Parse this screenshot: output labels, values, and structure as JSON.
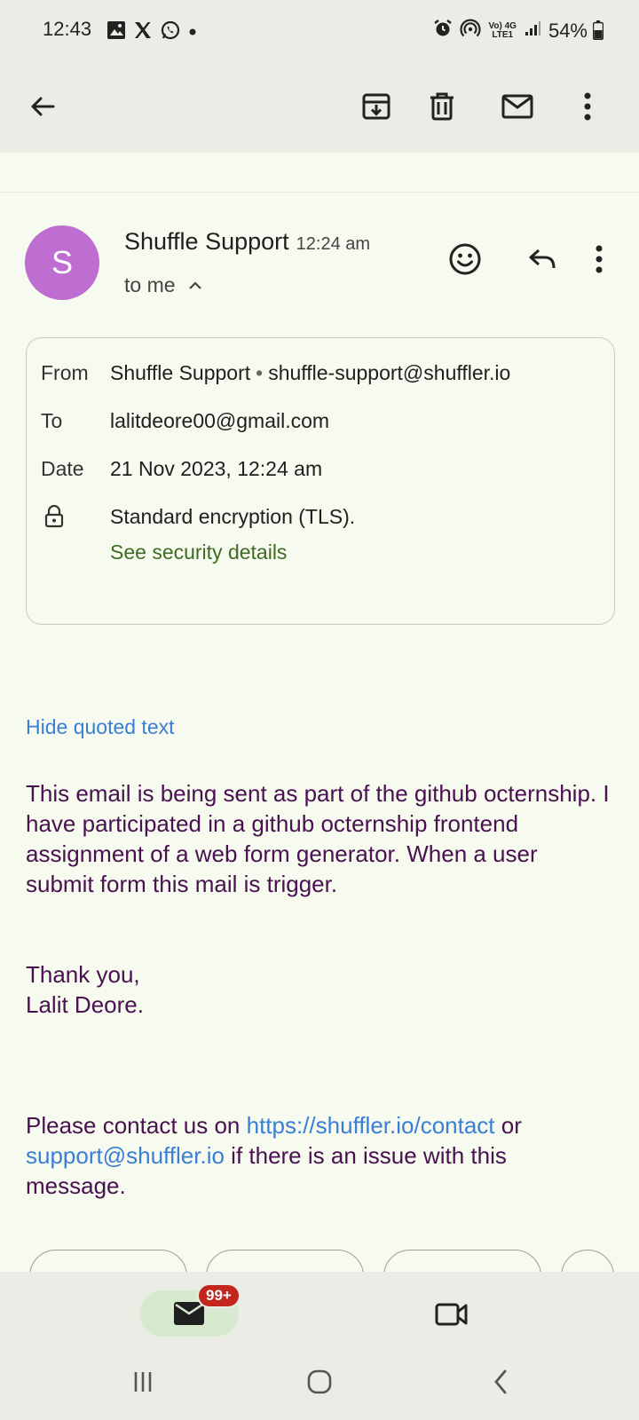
{
  "status_bar": {
    "time": "12:43",
    "battery": "54%",
    "net_top": "Vo) 4G",
    "net_bottom": "LTE1"
  },
  "toolbar": {
    "back": "back-arrow-icon",
    "archive": "archive-icon",
    "delete": "trash-icon",
    "mark_unread": "mail-icon",
    "more": "more-vert-icon"
  },
  "message": {
    "avatar_letter": "S",
    "avatar_color": "#bd6ed0",
    "sender": "Shuffle Support",
    "time": "12:24 am",
    "recipient_summary": "to me"
  },
  "details": {
    "from_label": "From",
    "from_name": "Shuffle Support",
    "from_sep": "•",
    "from_email": "shuffle-support@shuffler.io",
    "to_label": "To",
    "to_value": "lalitdeore00@gmail.com",
    "date_label": "Date",
    "date_value": "21 Nov 2023, 12:24 am",
    "encryption": "Standard encryption (TLS).",
    "security_link": "See security details"
  },
  "body": {
    "hide_quoted": "Hide quoted text",
    "paragraph1": "This email is being sent as part of the github octernship. I have participated in a github octernship frontend assignment of a web form generator. When a user submit form this mail is trigger.",
    "thanks": "Thank you,",
    "signature": "Lalit Deore.",
    "contact_prefix": "Please contact us on ",
    "contact_url": "https://shuffler.io/contact",
    "contact_or": " or ",
    "contact_email": "support@shuffler.io",
    "contact_suffix": " if there is an issue with this message."
  },
  "bottom_nav": {
    "mail_badge": "99+"
  },
  "colors": {
    "background": "#f6faef",
    "body_text": "#4a1150",
    "link": "#3a7fd6",
    "security_link": "#3f6c25",
    "badge": "#c3261f"
  }
}
